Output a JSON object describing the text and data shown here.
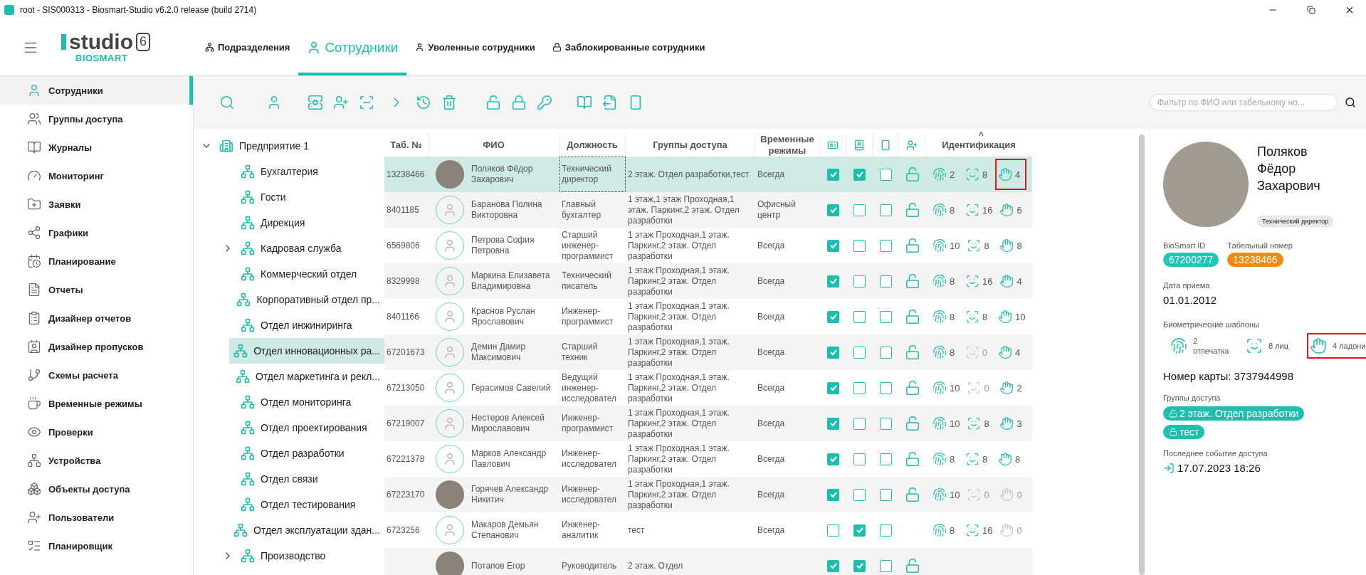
{
  "window": {
    "title": "root - SIS000313 - Biosmart-Studio v6.2.0 release (build 2714)"
  },
  "logo": {
    "word": "studio",
    "version": "6",
    "brand": "BIOSMART"
  },
  "nav_tabs": [
    {
      "label": "Подразделения",
      "selected": false
    },
    {
      "label": "Сотрудники",
      "selected": true
    },
    {
      "label": "Уволенные сотрудники",
      "selected": false
    },
    {
      "label": "Заблокированные сотрудники",
      "selected": false
    }
  ],
  "sidebar": {
    "items": [
      {
        "label": "Сотрудники",
        "selected": true
      },
      {
        "label": "Группы доступа",
        "selected": false
      },
      {
        "label": "Журналы",
        "selected": false
      },
      {
        "label": "Мониторинг",
        "selected": false
      },
      {
        "label": "Заявки",
        "selected": false
      },
      {
        "label": "Графики",
        "selected": false
      },
      {
        "label": "Планирование",
        "selected": false
      },
      {
        "label": "Отчеты",
        "selected": false
      },
      {
        "label": "Дизайнер отчетов",
        "selected": false
      },
      {
        "label": "Дизайнер пропусков",
        "selected": false
      },
      {
        "label": "Схемы расчета",
        "selected": false
      },
      {
        "label": "Временные режимы",
        "selected": false
      },
      {
        "label": "Проверки",
        "selected": false
      },
      {
        "label": "Устройства",
        "selected": false
      },
      {
        "label": "Объекты доступа",
        "selected": false
      },
      {
        "label": "Пользователи",
        "selected": false
      },
      {
        "label": "Планировщик",
        "selected": false
      }
    ]
  },
  "filter": {
    "placeholder": "Фильтр по ФИО или табельному но..."
  },
  "tree": {
    "items": [
      {
        "label": "Предприятие 1",
        "selected": false,
        "expanded": true,
        "children": [
          {
            "label": "Бухгалтерия",
            "selected": false
          },
          {
            "label": "Гости",
            "selected": false
          },
          {
            "label": "Дирекция",
            "selected": false
          },
          {
            "label": "Кадровая служба",
            "selected": false,
            "expanded": false
          },
          {
            "label": "Коммерческий отдел",
            "selected": false
          },
          {
            "label": "Корпоративный отдел пр...",
            "selected": false
          },
          {
            "label": "Отдел инжиниринга",
            "selected": false
          },
          {
            "label": "Отдел инновационных ра...",
            "selected": true
          },
          {
            "label": "Отдел маркетинга и рекл...",
            "selected": false
          },
          {
            "label": "Отдел мониторинга",
            "selected": false
          },
          {
            "label": "Отдел проектирования",
            "selected": false
          },
          {
            "label": "Отдел разработки",
            "selected": false
          },
          {
            "label": "Отдел связи",
            "selected": false
          },
          {
            "label": "Отдел тестирования",
            "selected": false
          },
          {
            "label": "Отдел эксплуатации здан...",
            "selected": false
          },
          {
            "label": "Производство",
            "selected": false,
            "expanded": false
          }
        ]
      }
    ]
  },
  "table": {
    "columns": [
      "Таб. №",
      "ФИО",
      "Должность",
      "Группы доступа",
      "Временные режимы",
      "Идентификация"
    ],
    "sort_indicator": "^",
    "rows": [
      {
        "selected": true,
        "focused": true,
        "tab": "13238466",
        "avatar": {
          "kind": "photo"
        },
        "name": "Поляков Фёдор Захарович",
        "position": "Технический директор",
        "groups": "2 этаж. Отдел разработки,тест",
        "schedule": "Всегда",
        "flags": [
          true,
          true,
          false
        ],
        "lock": true,
        "ids": [
          {
            "kind": "finger",
            "count": "2",
            "active": true
          },
          {
            "kind": "face",
            "count": "8",
            "active": true
          },
          {
            "kind": "palm",
            "count": "4",
            "active": true,
            "highlighted": true
          }
        ]
      },
      {
        "selected": false,
        "tab": "8401185",
        "avatar": {
          "kind": "placeholder"
        },
        "name": "Баранова Полина Викторовна",
        "position": "Главный бухгалтер",
        "groups": "1 этаж,1 этаж Проходная,1 этаж. Паркинг,2 этаж. Отдел разработки",
        "schedule": "Офисный центр",
        "flags": [
          true,
          false,
          false
        ],
        "lock": true,
        "ids": [
          {
            "kind": "finger",
            "count": "8",
            "active": true
          },
          {
            "kind": "face",
            "count": "16",
            "active": true
          },
          {
            "kind": "palm",
            "count": "6",
            "active": true
          }
        ]
      },
      {
        "selected": false,
        "tab": "6569806",
        "avatar": {
          "kind": "placeholder"
        },
        "name": "Петрова София Петровна",
        "position": "Старший инженер-программист",
        "groups": "1 этаж Проходная,1 этаж. Паркинг,2 этаж. Отдел разработки",
        "schedule": "Всегда",
        "flags": [
          true,
          false,
          false
        ],
        "lock": true,
        "ids": [
          {
            "kind": "finger",
            "count": "10",
            "active": true
          },
          {
            "kind": "face",
            "count": "8",
            "active": true
          },
          {
            "kind": "palm",
            "count": "8",
            "active": true
          }
        ]
      },
      {
        "selected": false,
        "tab": "8329998",
        "avatar": {
          "kind": "placeholder"
        },
        "name": "Маркина Елизавета Владимировна",
        "position": "Технический писатель",
        "groups": "1 этаж Проходная,1 этаж. Паркинг,2 этаж. Отдел разработки",
        "schedule": "Всегда",
        "flags": [
          true,
          false,
          false
        ],
        "lock": true,
        "ids": [
          {
            "kind": "finger",
            "count": "8",
            "active": true
          },
          {
            "kind": "face",
            "count": "16",
            "active": true
          },
          {
            "kind": "palm",
            "count": "4",
            "active": true
          }
        ]
      },
      {
        "selected": false,
        "tab": "8401166",
        "avatar": {
          "kind": "placeholder"
        },
        "name": "Краснов Руслан Ярославович",
        "position": "Инженер-программист",
        "groups": "1 этаж Проходная,1 этаж. Паркинг,2 этаж. Отдел разработки",
        "schedule": "Всегда",
        "flags": [
          true,
          false,
          false
        ],
        "lock": true,
        "ids": [
          {
            "kind": "finger",
            "count": "8",
            "active": true
          },
          {
            "kind": "face",
            "count": "8",
            "active": true
          },
          {
            "kind": "palm",
            "count": "10",
            "active": true
          }
        ]
      },
      {
        "selected": false,
        "tab": "67201673",
        "avatar": {
          "kind": "placeholder"
        },
        "name": "Демин Дамир Максимович",
        "position": "Старший техник",
        "groups": "1 этаж Проходная,1 этаж. Паркинг,2 этаж. Отдел разработки",
        "schedule": "Всегда",
        "flags": [
          true,
          false,
          false
        ],
        "lock": true,
        "ids": [
          {
            "kind": "finger",
            "count": "8",
            "active": true
          },
          {
            "kind": "face",
            "count": "0",
            "active": false
          },
          {
            "kind": "palm",
            "count": "4",
            "active": true
          }
        ]
      },
      {
        "selected": false,
        "tab": "67213050",
        "avatar": {
          "kind": "placeholder"
        },
        "name": "Герасимов Савелий",
        "position": "Ведущий инженер-исследовател",
        "groups": "1 этаж Проходная,1 этаж. Паркинг,2 этаж. Отдел разработки",
        "schedule": "Всегда",
        "flags": [
          true,
          false,
          false
        ],
        "lock": true,
        "ids": [
          {
            "kind": "finger",
            "count": "10",
            "active": true
          },
          {
            "kind": "face",
            "count": "0",
            "active": false
          },
          {
            "kind": "palm",
            "count": "2",
            "active": true
          }
        ]
      },
      {
        "selected": false,
        "tab": "67219007",
        "avatar": {
          "kind": "placeholder"
        },
        "name": "Нестеров Алексей Мирославович",
        "position": "Инженер-программист",
        "groups": "1 этаж Проходная,1 этаж. Паркинг,2 этаж. Отдел разработки",
        "schedule": "Всегда",
        "flags": [
          true,
          false,
          false
        ],
        "lock": true,
        "ids": [
          {
            "kind": "finger",
            "count": "10",
            "active": true
          },
          {
            "kind": "face",
            "count": "8",
            "active": true
          },
          {
            "kind": "palm",
            "count": "3",
            "active": true
          }
        ]
      },
      {
        "selected": false,
        "tab": "67221378",
        "avatar": {
          "kind": "placeholder"
        },
        "name": "Марков Александр Павлович",
        "position": "Инженер-исследовател",
        "groups": "1 этаж Проходная,1 этаж. Паркинг,2 этаж. Отдел разработки",
        "schedule": "Всегда",
        "flags": [
          true,
          false,
          false
        ],
        "lock": true,
        "ids": [
          {
            "kind": "finger",
            "count": "8",
            "active": true
          },
          {
            "kind": "face",
            "count": "8",
            "active": true
          },
          {
            "kind": "palm",
            "count": "8",
            "active": true
          }
        ]
      },
      {
        "selected": false,
        "tab": "67223170",
        "avatar": {
          "kind": "photo"
        },
        "name": "Горячев Александр Никитич",
        "position": "Инженер-исследовател",
        "groups": "1 этаж Проходная,1 этаж. Паркинг,2 этаж. Отдел разработки",
        "schedule": "Всегда",
        "flags": [
          true,
          false,
          false
        ],
        "lock": true,
        "ids": [
          {
            "kind": "finger",
            "count": "10",
            "active": true
          },
          {
            "kind": "face",
            "count": "0",
            "active": false
          },
          {
            "kind": "palm",
            "count": "0",
            "active": false
          }
        ]
      },
      {
        "selected": false,
        "tab": "6723256",
        "avatar": {
          "kind": "placeholder"
        },
        "name": "Макаров Демьян Степанович",
        "position": "Инженер-аналитик",
        "groups": "тест",
        "schedule": "Всегда",
        "flags": [
          false,
          true,
          false
        ],
        "lock": false,
        "ids": [
          {
            "kind": "finger",
            "count": "8",
            "active": true
          },
          {
            "kind": "face",
            "count": "16",
            "active": true
          },
          {
            "kind": "palm",
            "count": "0",
            "active": false
          }
        ]
      },
      {
        "selected": false,
        "avatar": {
          "kind": "photo"
        },
        "name": "Потапов Егор",
        "position": "Руководитель",
        "groups": "2 этаж. Отдел",
        "flags": [
          true,
          true,
          false
        ],
        "lock": true
      }
    ]
  },
  "details": {
    "name": "Поляков Фёдор Захарович",
    "position": "Технический директор",
    "ids": [
      {
        "label": "BioSmart ID",
        "value": "67200277",
        "color": "#1fc7b6"
      },
      {
        "label": "Табельный номер",
        "value": "13238466",
        "color": "#f08a12"
      }
    ],
    "hire_date": {
      "label": "Дата приема",
      "value": "01.01.2012"
    },
    "biometrics": {
      "label": "Биометрические шаблоны",
      "items": [
        {
          "kind": "finger",
          "text": "2 отпечатка"
        },
        {
          "kind": "face",
          "text": "8 лиц"
        },
        {
          "kind": "palm",
          "text": "4 ладони",
          "highlighted": true
        }
      ]
    },
    "card": "Номер карты: 3737944998",
    "groups": {
      "label": "Группы доступа",
      "items": [
        "2 этаж. Отдел разработки",
        "тест"
      ]
    },
    "last_event": {
      "label": "Последнее событие доступа",
      "value": "17.07.2023 18:26"
    }
  }
}
